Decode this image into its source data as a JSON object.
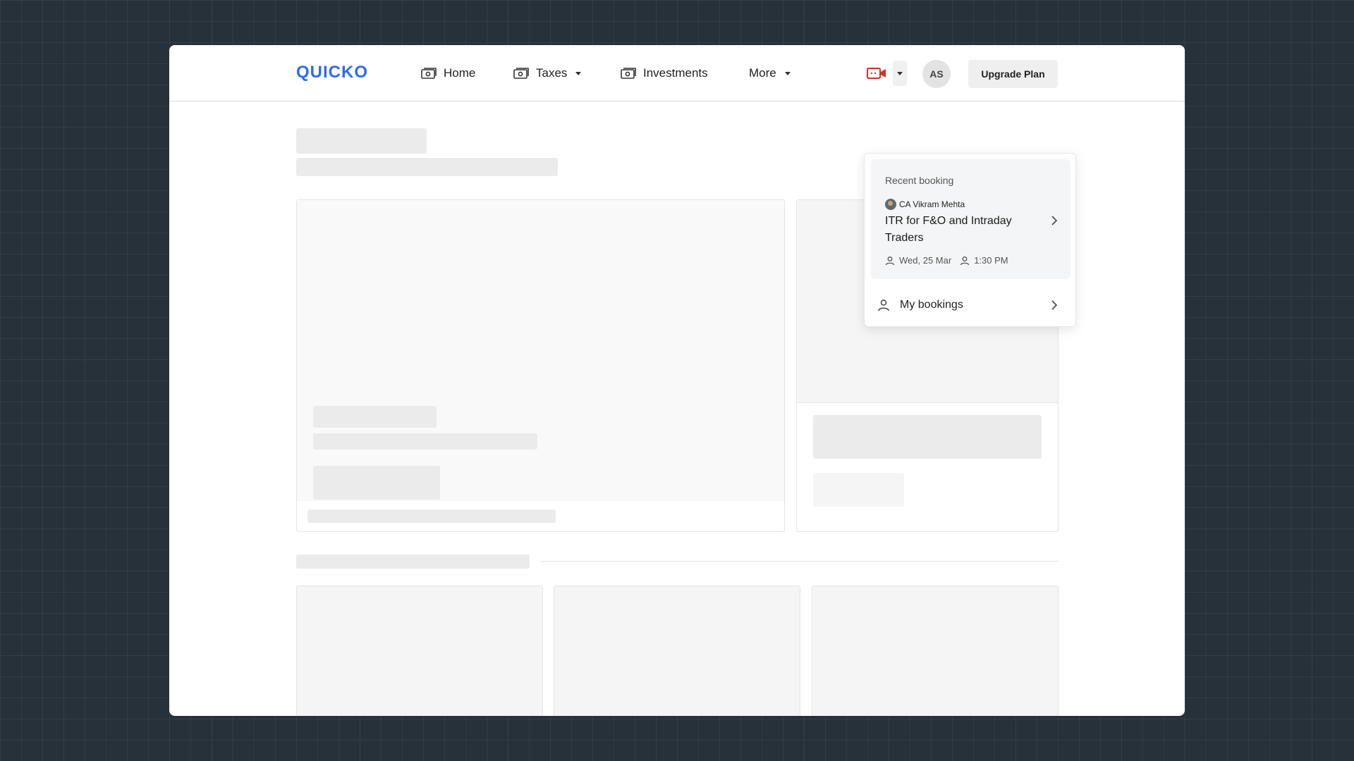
{
  "header": {
    "logo_text": "QUICKO",
    "nav": [
      {
        "label": "Home",
        "icon": "money-icon",
        "has_caret": false
      },
      {
        "label": "Taxes",
        "icon": "money-icon",
        "has_caret": true
      },
      {
        "label": "Investments",
        "icon": "money-icon",
        "has_caret": false
      },
      {
        "label": "More",
        "icon": "",
        "has_caret": true
      }
    ],
    "video_icon": "video-call-icon",
    "avatar_initials": "AS",
    "upgrade_label": "Upgrade Plan"
  },
  "dropdown": {
    "recent_label": "Recent booking",
    "ca_name": "CA Vikram Mehta",
    "booking_title": "ITR for F&O and Intraday Traders",
    "date": "Wed, 25 Mar",
    "time": "1:30 PM",
    "my_bookings_label": "My bookings"
  },
  "colors": {
    "brand": "#2f6bf0",
    "video_icon": "#d93025",
    "background": "#27313a"
  }
}
